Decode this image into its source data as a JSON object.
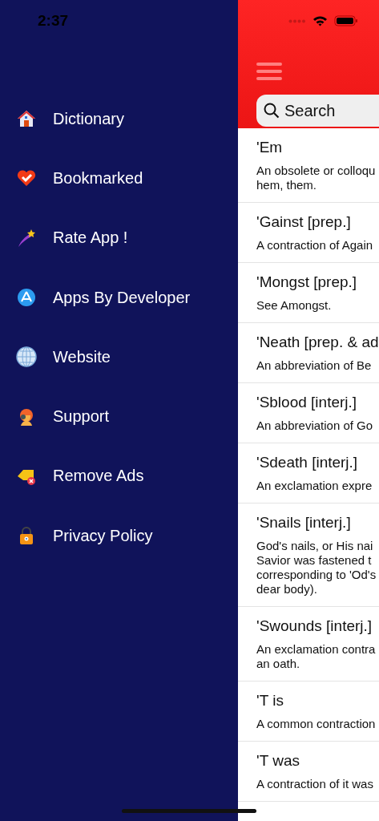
{
  "status_bar": {
    "time": "2:37"
  },
  "drawer": {
    "items": [
      {
        "label": "Dictionary"
      },
      {
        "label": "Bookmarked"
      },
      {
        "label": "Rate App !"
      },
      {
        "label": "Apps By Developer"
      },
      {
        "label": "Website"
      },
      {
        "label": "Support"
      },
      {
        "label": "Remove Ads"
      },
      {
        "label": "Privacy Policy"
      }
    ]
  },
  "search": {
    "placeholder": "Search"
  },
  "entries": [
    {
      "word": "'Em",
      "definition": "An obsolete or colloqu\nhem, them."
    },
    {
      "word": "'Gainst [prep.]",
      "definition": "A contraction of Again"
    },
    {
      "word": "'Mongst [prep.]",
      "definition": "See Amongst."
    },
    {
      "word": "'Neath [prep. & ad",
      "definition": "An abbreviation of Be"
    },
    {
      "word": "'Sblood [interj.]",
      "definition": "An abbreviation of Go"
    },
    {
      "word": "'Sdeath [interj.]",
      "definition": "An exclamation expre"
    },
    {
      "word": "'Snails [interj.]",
      "definition": "God's nails, or His nai\nSavior was fastened t\ncorresponding to 'Od's\ndear body)."
    },
    {
      "word": "'Swounds [interj.]",
      "definition": "An exclamation contra\nan oath."
    },
    {
      "word": "'T is",
      "definition": "A common contraction"
    },
    {
      "word": "'T was",
      "definition": "A contraction of it was"
    }
  ]
}
